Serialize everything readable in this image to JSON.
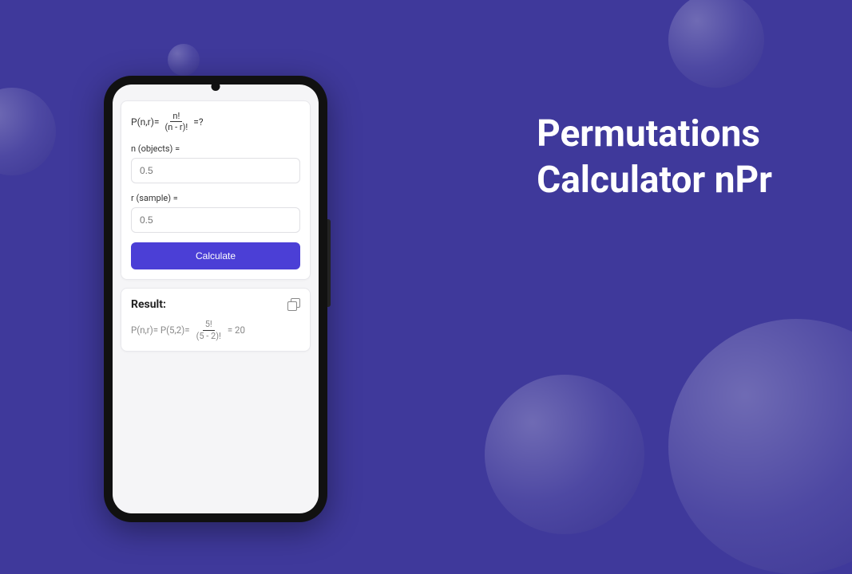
{
  "title_line1": "Permutations",
  "title_line2": "Calculator nPr",
  "formula": {
    "prefix": "P(n,r)=",
    "numerator": "n!",
    "denominator": "(n - r)!",
    "suffix": "=?"
  },
  "input_n": {
    "label": "n (objects) =",
    "placeholder": "0.5"
  },
  "input_r": {
    "label": "r (sample) =",
    "placeholder": "0.5"
  },
  "calculate_label": "Calculate",
  "result": {
    "title": "Result:",
    "prefix": "P(n,r)= P(5,2)=",
    "numerator": "5!",
    "denominator": "(5 - 2)!",
    "suffix": "= 20"
  }
}
